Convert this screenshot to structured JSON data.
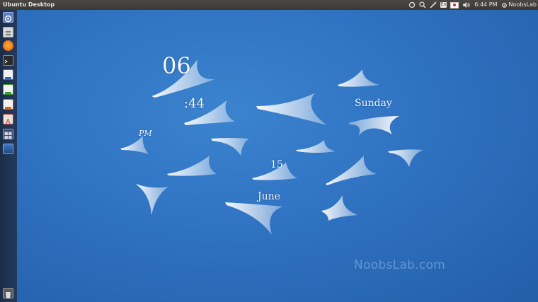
{
  "panel": {
    "window_title": "Ubuntu Desktop",
    "keyboard_layout": "En",
    "clock": "6:44 PM",
    "session_user": "NoobsLab"
  },
  "launcher": {
    "items": [
      "dash-home-icon",
      "files-icon",
      "firefox-icon",
      "terminal-icon",
      "libreoffice-writer-icon",
      "libreoffice-calc-icon",
      "libreoffice-impress-icon",
      "software-center-icon",
      "workspace-switcher-icon",
      "desktop-icon",
      "trash-icon"
    ]
  },
  "clock_widget": {
    "hour": "06",
    "minute": ":44",
    "meridiem": "PM",
    "day": "Sunday",
    "date": "15",
    "month": "June"
  },
  "watermark": "NoobsLab.com",
  "colors": {
    "wallpaper": "#2f72c1",
    "panel": "#3c3b37",
    "launcher": "#1f3350"
  }
}
